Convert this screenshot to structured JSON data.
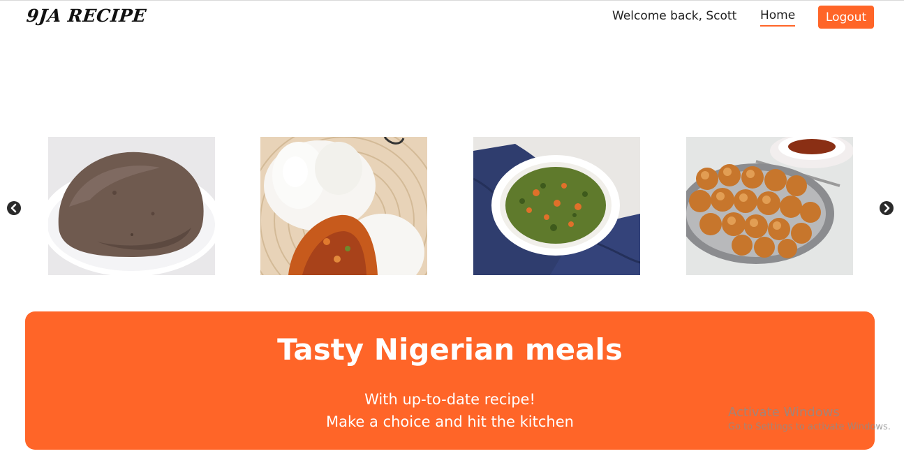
{
  "header": {
    "logo_text": "9JA RECIPE",
    "welcome_text": "Welcome back, Scott",
    "nav_home_label": "Home",
    "logout_label": "Logout"
  },
  "carousel": {
    "prev_icon": "chevron-left-icon",
    "next_icon": "chevron-right-icon",
    "slides": [
      {
        "name": "food-image-amala"
      },
      {
        "name": "food-image-pounded-yam-stew"
      },
      {
        "name": "food-image-vegetable-soup"
      },
      {
        "name": "food-image-puff-puff"
      }
    ]
  },
  "hero": {
    "title": "Tasty Nigerian meals",
    "line1": "With up-to-date recipe!",
    "line2": "Make a choice and hit the kitchen"
  },
  "watermark": {
    "title": "Activate Windows",
    "subtitle": "Go to Settings to activate Windows."
  },
  "colors": {
    "accent": "#ff6528",
    "text": "#222222",
    "background": "#ffffff"
  }
}
